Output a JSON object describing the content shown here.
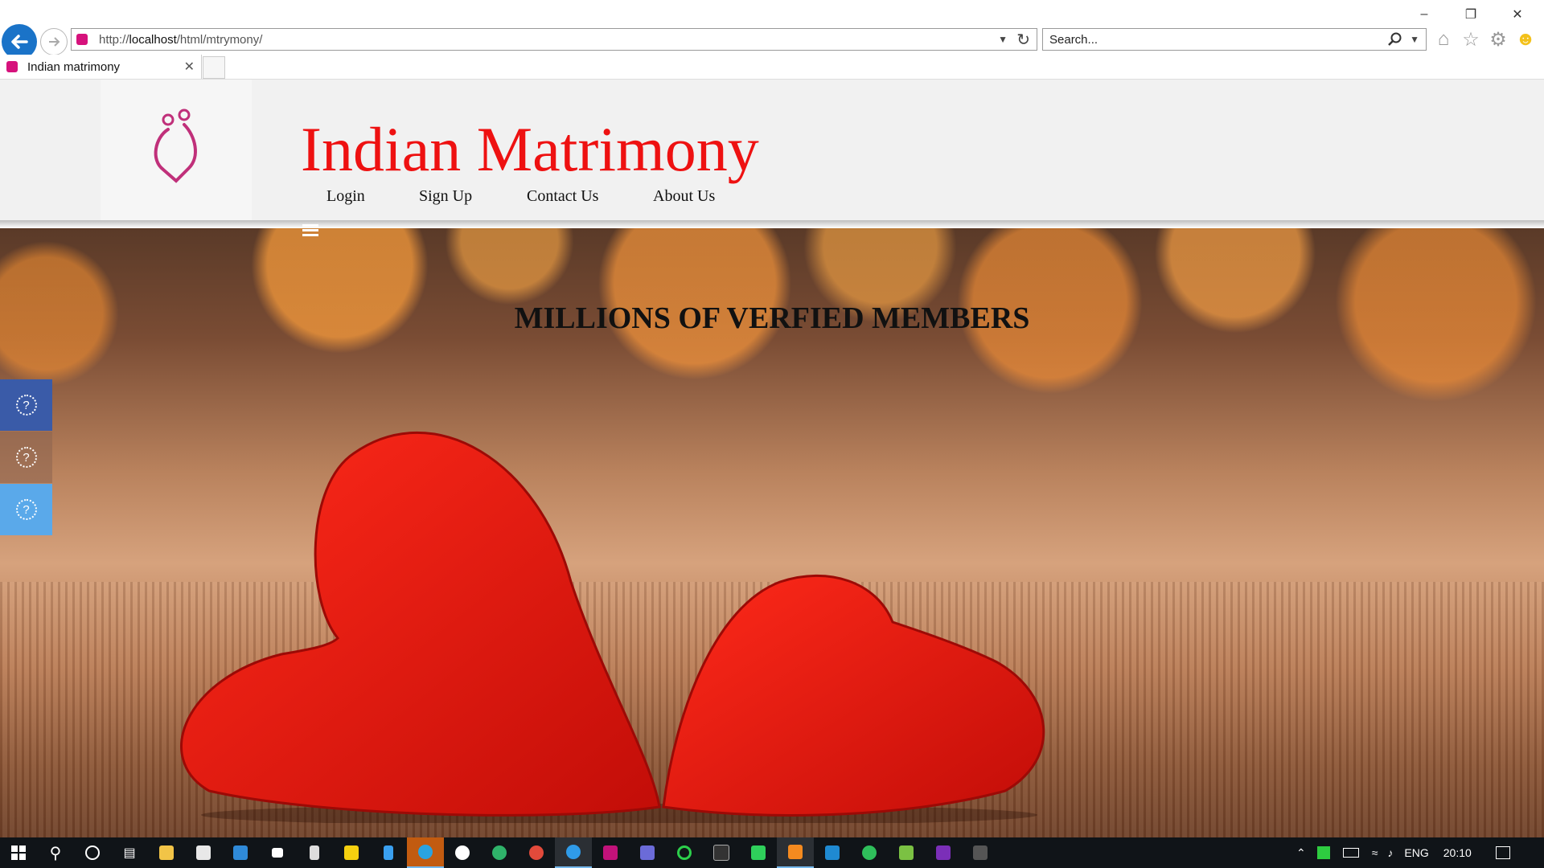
{
  "browser": {
    "url_prefix": "http://",
    "url_host": "localhost",
    "url_path": "/html/mtrymony/",
    "search_placeholder": "Search...",
    "tab_title": "Indian matrimony",
    "accent": "#1a73c8"
  },
  "site": {
    "title": "Indian Matrimony",
    "title_color": "#ee1111",
    "nav": [
      {
        "label": "Login"
      },
      {
        "label": "Sign Up"
      },
      {
        "label": "Contact Us"
      },
      {
        "label": "About Us"
      }
    ],
    "hero_heading": "MILLIONS OF VERFIED MEMBERS",
    "side_buttons": [
      {
        "icon": "help-circle-icon",
        "color": "#3a5ba8",
        "glyph": "?"
      },
      {
        "icon": "help-circle-icon",
        "color": "#8a6a58",
        "glyph": "?"
      },
      {
        "icon": "help-circle-icon",
        "color": "#5aa9ea",
        "glyph": "?"
      }
    ]
  },
  "taskbar": {
    "lang": "ENG",
    "time": "20:10"
  }
}
